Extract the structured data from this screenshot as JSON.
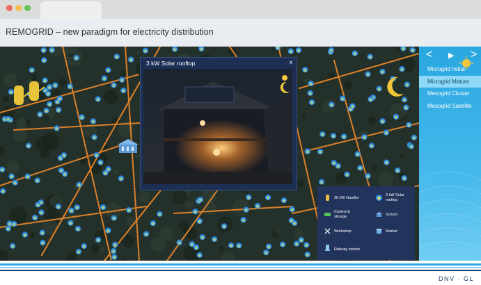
{
  "window": {
    "controls": [
      "close",
      "minimize",
      "maximize"
    ]
  },
  "header": {
    "title": "REMOGRID – new paradigm for electricity distribution"
  },
  "popup": {
    "title": "3 kW Solar rooftop",
    "close_label": "x"
  },
  "sidebar": {
    "prev_label": "<",
    "play_label": "▶",
    "next_label": ">",
    "items": [
      {
        "label": "Microgrid Initial"
      },
      {
        "label": "Microgrid Mature"
      },
      {
        "label": "Mesogrid Cluster"
      },
      {
        "label": "Mesogrid Satellite"
      }
    ],
    "active_index": 1
  },
  "legend": {
    "items": [
      {
        "label": "20 kW Gasifier",
        "icon": "gasifier-icon"
      },
      {
        "label": "3 kW Solar rooftop",
        "icon": "solar-rooftop-icon"
      },
      {
        "label": "Control & storage",
        "icon": "battery-icon"
      },
      {
        "label": "School",
        "icon": "school-icon"
      },
      {
        "label": "Workshop",
        "icon": "tools-icon"
      },
      {
        "label": "Market",
        "icon": "market-icon"
      },
      {
        "label": "Railway station",
        "icon": "railway-icon"
      }
    ]
  },
  "brand": {
    "name": "DNV · GL"
  },
  "colors": {
    "accent": "#2aa7e0",
    "panel": "#1d2f55",
    "road_glow": "#f08a2a",
    "house_blue": "#2b8fe8",
    "house_yellow": "#f3e04a"
  }
}
